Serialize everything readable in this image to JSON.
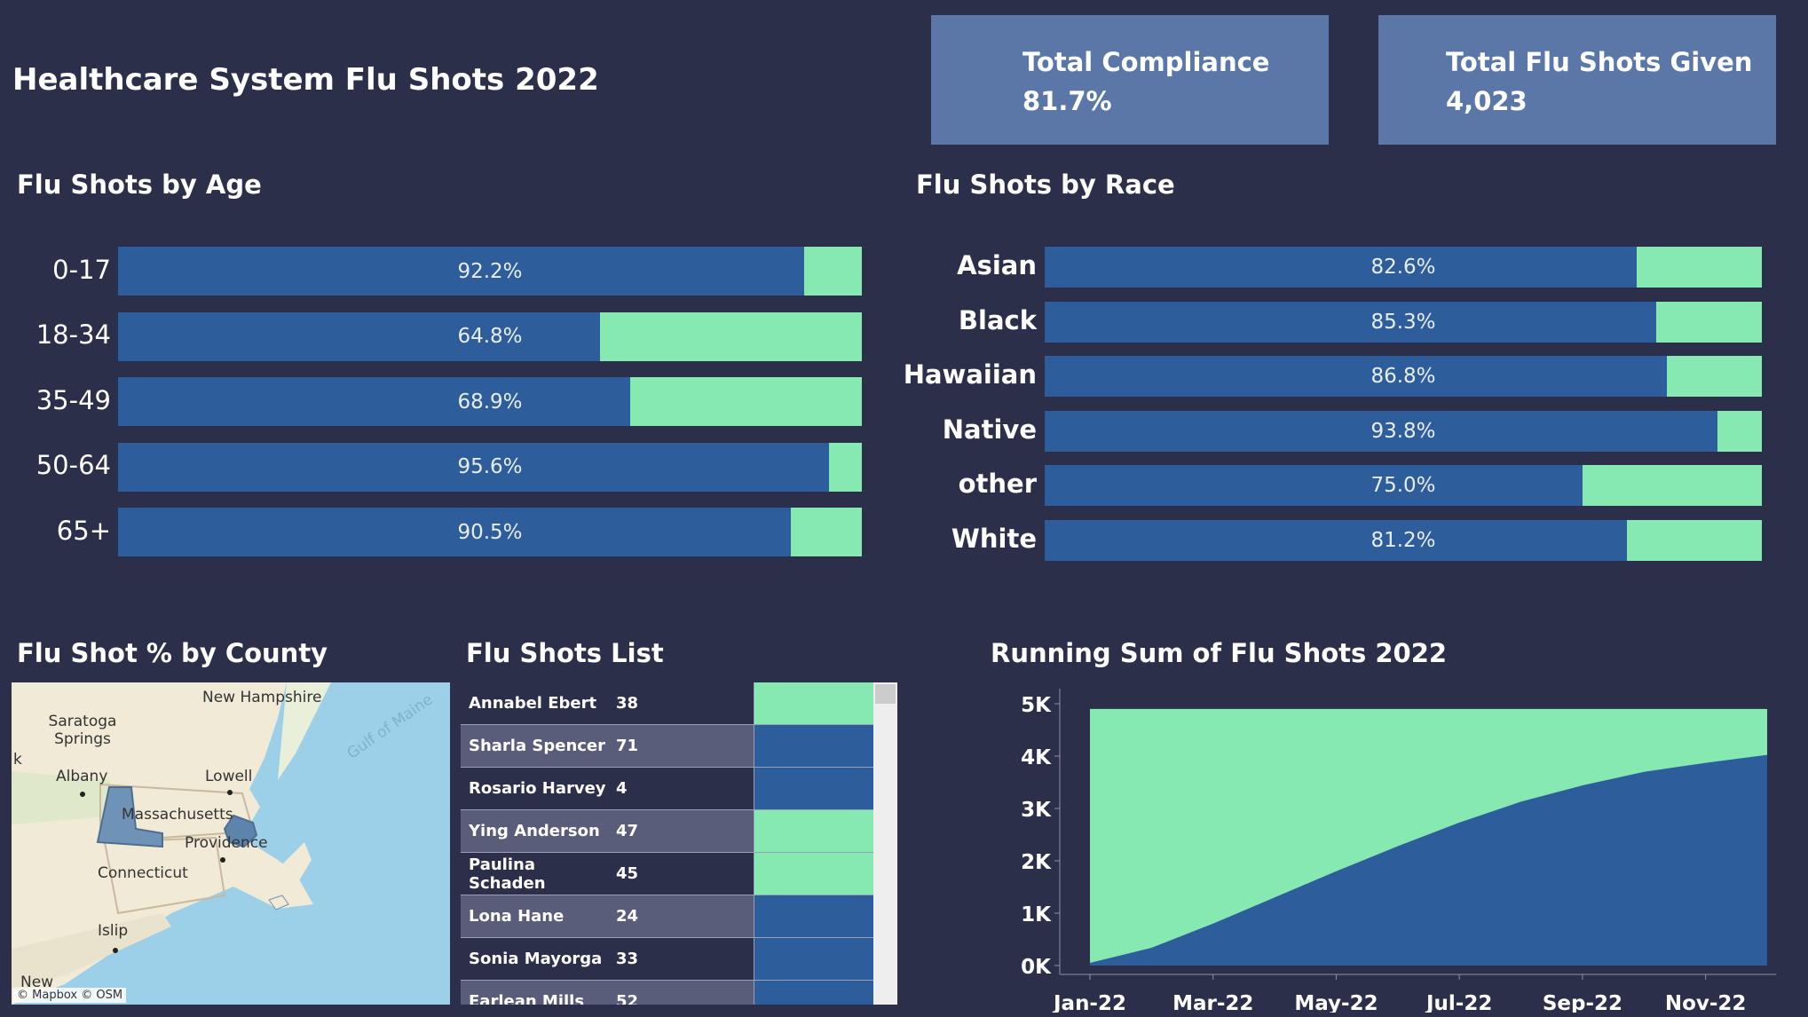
{
  "title": "Healthcare System Flu Shots 2022",
  "kpis": {
    "compliance": {
      "label": "Total Compliance",
      "value": "81.7%"
    },
    "total": {
      "label": "Total Flu Shots Given",
      "value": "4,023"
    }
  },
  "colors": {
    "background": "#2b2f4a",
    "fill": "#2d5d9a",
    "remainder": "#86e9b1",
    "kpi": "#5a77a8"
  },
  "age_chart": {
    "title": "Flu Shots by Age",
    "rows": [
      {
        "label": "0-17",
        "pct": 92.2,
        "text": "92.2%"
      },
      {
        "label": "18-34",
        "pct": 64.8,
        "text": "64.8%"
      },
      {
        "label": "35-49",
        "pct": 68.9,
        "text": "68.9%"
      },
      {
        "label": "50-64",
        "pct": 95.6,
        "text": "95.6%"
      },
      {
        "label": "65+",
        "pct": 90.5,
        "text": "90.5%"
      }
    ]
  },
  "race_chart": {
    "title": "Flu Shots by Race",
    "rows": [
      {
        "label": "Asian",
        "pct": 82.6,
        "text": "82.6%"
      },
      {
        "label": "Black",
        "pct": 85.3,
        "text": "85.3%"
      },
      {
        "label": "Hawaiian",
        "pct": 86.8,
        "text": "86.8%"
      },
      {
        "label": "Native",
        "pct": 93.8,
        "text": "93.8%"
      },
      {
        "label": "other",
        "pct": 75.0,
        "text": "75.0%"
      },
      {
        "label": "White",
        "pct": 81.2,
        "text": "81.2%"
      }
    ]
  },
  "map": {
    "title": "Flu Shot % by County",
    "places": [
      "New Hampshire",
      "Saratoga Springs",
      "Albany",
      "Lowell",
      "Massachusetts",
      "Providence",
      "Connecticut",
      "Islip",
      "Gulf of Maine",
      "k",
      "New"
    ],
    "attribution": "© Mapbox  © OSM"
  },
  "list": {
    "title": "Flu Shots List",
    "rows": [
      {
        "name": "Annabel Ebert",
        "age": "38",
        "flag": "green"
      },
      {
        "name": "Sharla Spencer",
        "age": "71",
        "flag": "blue"
      },
      {
        "name": "Rosario Harvey",
        "age": "4",
        "flag": "blue"
      },
      {
        "name": "Ying Anderson",
        "age": "47",
        "flag": "green"
      },
      {
        "name": "Paulina Schaden",
        "age": "45",
        "flag": "green"
      },
      {
        "name": "Lona Hane",
        "age": "24",
        "flag": "blue"
      },
      {
        "name": "Sonia Mayorga",
        "age": "33",
        "flag": "blue"
      },
      {
        "name": "Earlean Mills",
        "age": "52",
        "flag": "blue"
      }
    ]
  },
  "chart_data": {
    "type": "area",
    "title": "Running Sum of Flu Shots 2022",
    "x": [
      "Jan-22",
      "Feb-22",
      "Mar-22",
      "Apr-22",
      "May-22",
      "Jun-22",
      "Jul-22",
      "Aug-22",
      "Sep-22",
      "Oct-22",
      "Nov-22",
      "Dec-22"
    ],
    "x_ticks": [
      "Jan-22",
      "Mar-22",
      "May-22",
      "Jul-22",
      "Sep-22",
      "Nov-22"
    ],
    "series": [
      {
        "values": [
          50,
          340,
          800,
          1300,
          1800,
          2280,
          2730,
          3130,
          3440,
          3700,
          3870,
          4023
        ]
      }
    ],
    "background_total": 4900,
    "y_ticks": [
      0,
      1000,
      2000,
      3000,
      4000,
      5000
    ],
    "y_tick_labels": [
      "0K",
      "1K",
      "2K",
      "3K",
      "4K",
      "5K"
    ],
    "ylim": [
      0,
      5000
    ],
    "grid": false
  }
}
